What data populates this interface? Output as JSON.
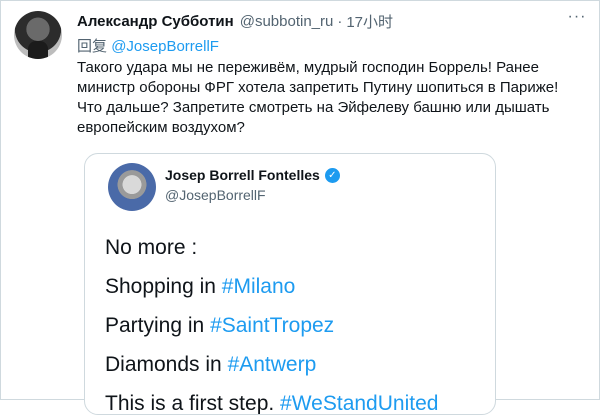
{
  "author": {
    "name": "Александр Субботин",
    "handle": "@subbotin_ru",
    "separator": "·",
    "time": "17小时"
  },
  "more_label": "···",
  "reply_to": {
    "prefix": "回复",
    "mention": "@JosepBorrellF"
  },
  "tweet_text": "Такого удара мы не переживём, мудрый господин Боррель! Ранее министр обороны ФРГ хотела запретить Путину шопиться в Париже! Что дальше? Запретите смотреть на Эйфелеву башню или дышать европейским воздухом?",
  "quote": {
    "name": "Josep Borrell Fontelles",
    "verified_glyph": "✓",
    "handle": "@JosepBorrellF",
    "lines": [
      {
        "text": "No more :",
        "tag": ""
      },
      {
        "text": "Shopping in ",
        "tag": "#Milano"
      },
      {
        "text": "Partying in ",
        "tag": "#SaintTropez"
      },
      {
        "text": "Diamonds in ",
        "tag": "#Antwerp"
      },
      {
        "text": "This is a first step. ",
        "tag": "#WeStandUnited"
      }
    ]
  },
  "colors": {
    "link": "#1d9bf0",
    "secondary_text": "#536471",
    "border": "#cfd9de"
  },
  "icons": {
    "author_avatar": "avatar",
    "quote_avatar": "avatar",
    "verified": "verified-badge-icon",
    "more": "more-options-icon"
  }
}
